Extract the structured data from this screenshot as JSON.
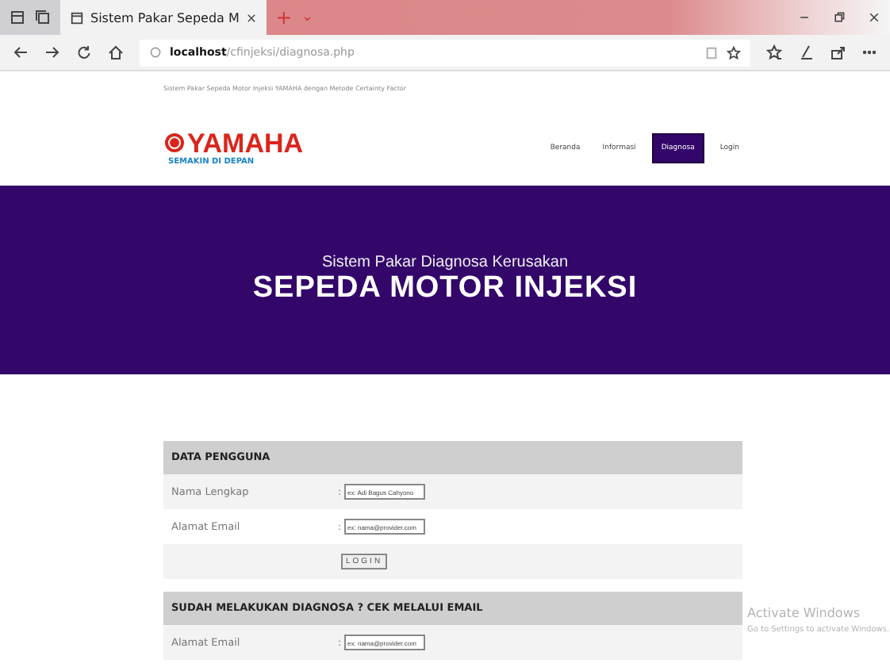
{
  "browser": {
    "tabs": [
      {
        "title": "Sistem Pakar Sepeda M",
        "selected": true
      }
    ],
    "new_tab": "+",
    "tab_menu": "⌄",
    "url_host": "localhost",
    "url_path": "/cfinjeksi/diagnosa.php"
  },
  "page": {
    "tagline": "Sistem Pakar Sepeda Motor Injeksi YAMAHA dengan Metode Certainty Factor",
    "logo": {
      "brand": "YAMAHA",
      "slogan": "SEMAKIN DI DEPAN"
    },
    "nav": [
      {
        "label": "Beranda",
        "selected": false
      },
      {
        "label": "Informasi",
        "selected": false
      },
      {
        "label": "Diagnosa",
        "selected": true
      },
      {
        "label": "Login",
        "selected": false
      }
    ],
    "hero": {
      "subtitle": "Sistem Pakar Diagnosa Kerusakan",
      "title": "SEPEDA MOTOR INJEKSI"
    },
    "sections": [
      {
        "title": "DATA PENGGUNA",
        "rows": [
          {
            "kind": "input",
            "label": "Nama Lengkap",
            "separator": ":",
            "placeholder": "ex: Adi Bagus Cahyono"
          },
          {
            "kind": "input",
            "label": "Alamat Email",
            "separator": ":",
            "placeholder": "ex: nama@provider.com"
          },
          {
            "kind": "button",
            "label": "LOGIN"
          }
        ]
      },
      {
        "title": "SUDAH MELAKUKAN DIAGNOSA ? CEK MELALUI EMAIL",
        "rows": [
          {
            "kind": "input",
            "label": "Alamat Email",
            "separator": ":",
            "placeholder": "ex: nama@provider.com"
          }
        ]
      }
    ]
  },
  "os_notice": {
    "title": "Activate Windows",
    "text": "Go to Settings to activate Windows."
  }
}
